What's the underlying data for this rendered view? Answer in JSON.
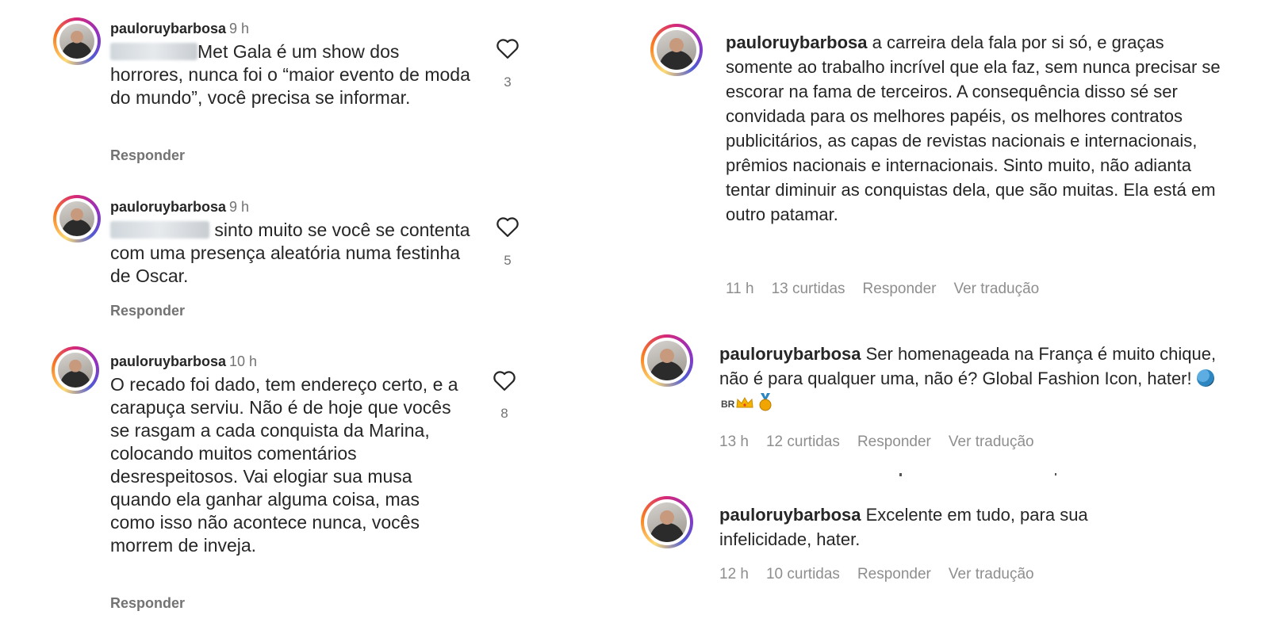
{
  "left_comments": [
    {
      "username": "pauloruybarbosa",
      "time": "9 h",
      "text": "Met Gala é um show dos horrores, nunca foi o “maior evento de moda do mundo”, você precisa se informar.",
      "likes": "3",
      "reply_label": "Responder"
    },
    {
      "username": "pauloruybarbosa",
      "time": "9 h",
      "text": "sinto muito se você se contenta com uma presença aleatória numa festinha de Oscar.",
      "likes": "5",
      "reply_label": "Responder"
    },
    {
      "username": "pauloruybarbosa",
      "time": "10 h",
      "text": "O recado foi dado, tem endereço certo, e a carapuça serviu. Não é de hoje que vocês se rasgam a cada conquista da Marina, colocando muitos comentários desrespeitosos. Vai elogiar sua musa quando ela ganhar alguma coisa, mas como isso não acontece nunca, vocês morrem de inveja.",
      "likes": "8",
      "reply_label": "Responder"
    }
  ],
  "right_comments": [
    {
      "username": "pauloruybarbosa",
      "text": "a carreira dela fala por si só, e graças somente ao trabalho incrível que ela faz, sem nunca precisar se escorar na fama de terceiros. A consequência disso sé ser convidada para os melhores papéis, os melhores contratos publicitários, as capas de revistas nacionais e internacionais, prêmios nacionais e internacionais. Sinto muito, não adianta tentar diminuir as conquistas dela, que são muitas. Ela está em outro patamar.",
      "time": "11 h",
      "likes": "13 curtidas",
      "reply_label": "Responder",
      "translate_label": "Ver tradução"
    },
    {
      "username": "pauloruybarbosa",
      "text": "Ser homenageada na França é muito chique, não é para qualquer uma, não é? Global Fashion Icon, hater!",
      "emoji_flag_text": "BR",
      "time": "13 h",
      "likes": "12 curtidas",
      "reply_label": "Responder",
      "translate_label": "Ver tradução"
    },
    {
      "username": "pauloruybarbosa",
      "text": "Excelente em tudo, para sua infelicidade, hater.",
      "time": "12 h",
      "likes": "10 curtidas",
      "reply_label": "Responder",
      "translate_label": "Ver tradução"
    }
  ],
  "icons": {
    "like": "heart-icon",
    "avatar": "avatar"
  },
  "colors": {
    "text": "#262626",
    "muted": "#737373",
    "meta": "#8e8e8e"
  }
}
